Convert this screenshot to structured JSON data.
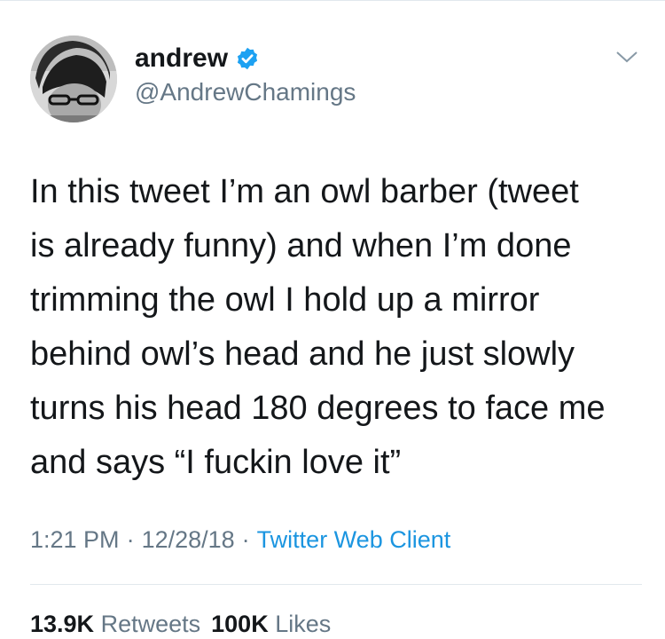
{
  "author": {
    "display_name": "andrew",
    "handle": "@AndrewChamings",
    "verified_icon": "verified-badge-icon"
  },
  "tweet": {
    "text": "In this tweet I’m an owl barber (tweet\nis already funny) and when I’m done\ntrimming the owl I hold up a mirror\nbehind owl’s head and he just slowly\nturns his head 180 degrees to face me\nand says “I fuckin love it”"
  },
  "meta": {
    "time": "1:21 PM",
    "separator": "·",
    "date": "12/28/18",
    "client": "Twitter Web Client"
  },
  "stats": {
    "retweets_count": "13.9K",
    "retweets_label": "Retweets",
    "likes_count": "100K",
    "likes_label": "Likes"
  },
  "colors": {
    "text": "#14171a",
    "secondary": "#657786",
    "link": "#1b95e0",
    "verified": "#1da1f2",
    "divider": "#e1e8ed"
  }
}
